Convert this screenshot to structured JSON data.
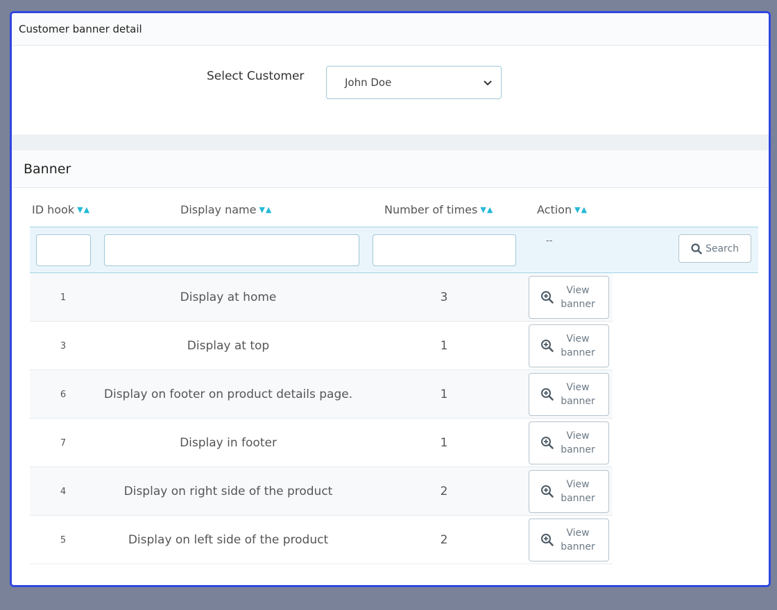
{
  "header": {
    "title": "Customer banner detail"
  },
  "customer": {
    "label": "Select Customer",
    "selected": "John Doe"
  },
  "banner": {
    "title": "Banner",
    "columns": [
      "ID hook",
      "Display name",
      "Number of times",
      "Action"
    ],
    "sort_glyph": "▼▲",
    "filter_placeholder": "--",
    "search_label": "Search",
    "rows": [
      {
        "id": "1",
        "name": "Display at home",
        "times": "3",
        "action": "View banner"
      },
      {
        "id": "3",
        "name": "Display at top",
        "times": "1",
        "action": "View banner"
      },
      {
        "id": "6",
        "name": "Display on footer on product details page.",
        "times": "1",
        "action": "View banner"
      },
      {
        "id": "7",
        "name": "Display in footer",
        "times": "1",
        "action": "View banner"
      },
      {
        "id": "4",
        "name": "Display on right side of the product",
        "times": "2",
        "action": "View banner"
      },
      {
        "id": "5",
        "name": "Display on left side of the product",
        "times": "2",
        "action": "View banner"
      }
    ]
  },
  "colors": {
    "accent": "#25b9d7",
    "frame_border": "#2f47e0",
    "backdrop": "#7a8299"
  },
  "icons": {
    "search": "search-icon",
    "view": "zoom-in-icon",
    "select": "chevron-down-icon"
  }
}
